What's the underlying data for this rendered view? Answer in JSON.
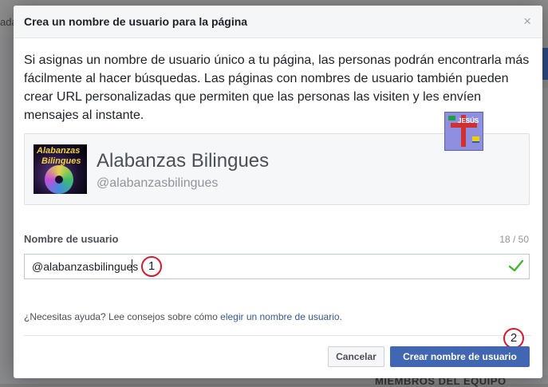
{
  "background": {
    "left_text": "ada",
    "bottom_text": "MIEMBROS DEL EQUIPO",
    "right_mark": "t",
    "right_link": "l"
  },
  "dialog": {
    "title": "Crea un nombre de usuario para la página",
    "close_glyph": "×",
    "description": "Si asignas un nombre de usuario único a tu página, las personas podrán encontrarla más fácilmente al hacer búsquedas. Las páginas con nombres de usuario también pueden crear URL personalizadas que permiten que las personas las visiten y les envíen mensajes al instante."
  },
  "page_card": {
    "name": "Alabanzas Bilingues",
    "handle": "@alabanzasbilingues",
    "avatar_text_1": "Alabanzas",
    "avatar_text_2": "Bilingues"
  },
  "badge": {
    "text": "JESÚS"
  },
  "username": {
    "label": "Nombre de usuario",
    "counter": "18 / 50",
    "value": "@alabanzasbilingues",
    "status_icon": "check-icon",
    "valid_color": "#42b72a"
  },
  "help": {
    "prefix": "¿Necesitas ayuda? Lee consejos sobre cómo ",
    "link": "elegir un nombre de usuario",
    "suffix": "."
  },
  "buttons": {
    "cancel": "Cancelar",
    "create": "Crear nombre de usuario"
  },
  "annotations": {
    "one": "1",
    "two": "2",
    "color": "#e0162b"
  },
  "colors": {
    "primary": "#4267b2",
    "link": "#365899"
  }
}
